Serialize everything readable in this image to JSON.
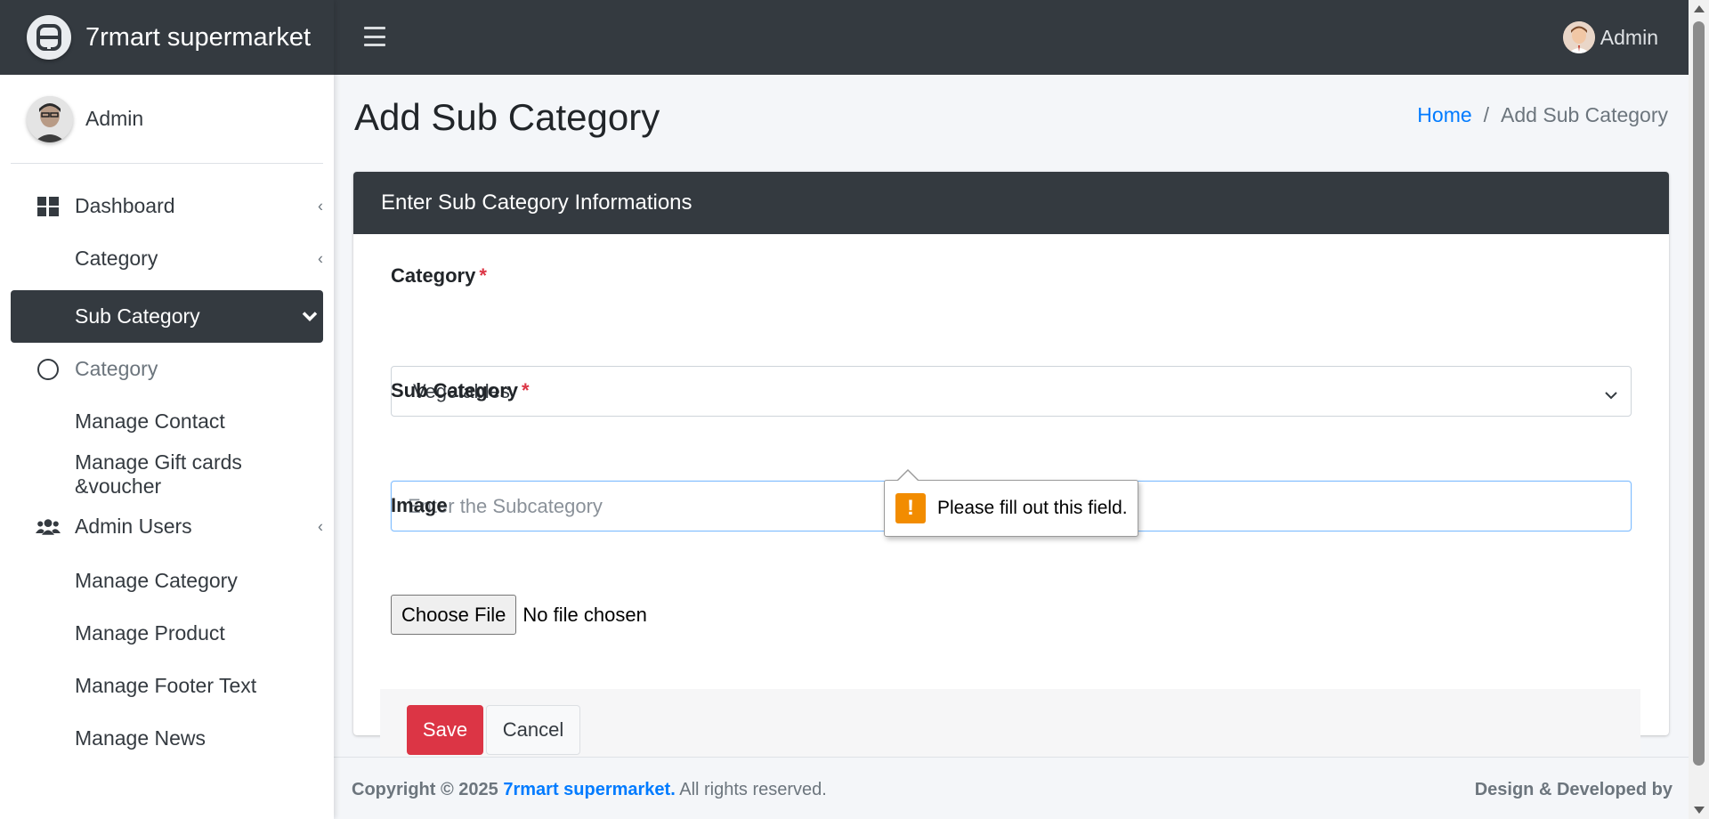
{
  "brand": {
    "name": "7rmart supermarket"
  },
  "sidebar": {
    "user_name": "Admin",
    "items": [
      {
        "label": "Dashboard"
      },
      {
        "label": "Category"
      },
      {
        "label": "Sub Category"
      },
      {
        "label": "Category"
      },
      {
        "label": "Manage Contact"
      },
      {
        "label": "Manage Gift cards &voucher"
      },
      {
        "label": "Admin Users"
      },
      {
        "label": "Manage Category"
      },
      {
        "label": "Manage Product"
      },
      {
        "label": "Manage Footer Text"
      },
      {
        "label": "Manage News"
      }
    ]
  },
  "topbar": {
    "user_name": "Admin"
  },
  "page": {
    "title": "Add Sub Category",
    "breadcrumb": {
      "home": "Home",
      "separator": "/",
      "current": "Add Sub Category"
    }
  },
  "form": {
    "header": "Enter Sub Category Informations",
    "category_label": "Category",
    "category_required": "*",
    "category_value": "Vegetables",
    "subcategory_label": "Sub Category",
    "subcategory_required": "*",
    "subcategory_placeholder": "Enter the Subcategory",
    "image_label": "Image",
    "file_button": "Choose File",
    "file_status": "No file chosen",
    "save_label": "Save",
    "cancel_label": "Cancel"
  },
  "validation": {
    "message": "Please fill out this field."
  },
  "footer": {
    "copyright_prefix": "Copyright © 2025",
    "brand_link": "7rmart supermarket.",
    "rights": "All rights reserved.",
    "design_credit": "Design & Developed by"
  },
  "colors": {
    "dark": "#343a40",
    "link": "#007bff",
    "danger": "#dc3545",
    "warning": "#f28c00"
  }
}
